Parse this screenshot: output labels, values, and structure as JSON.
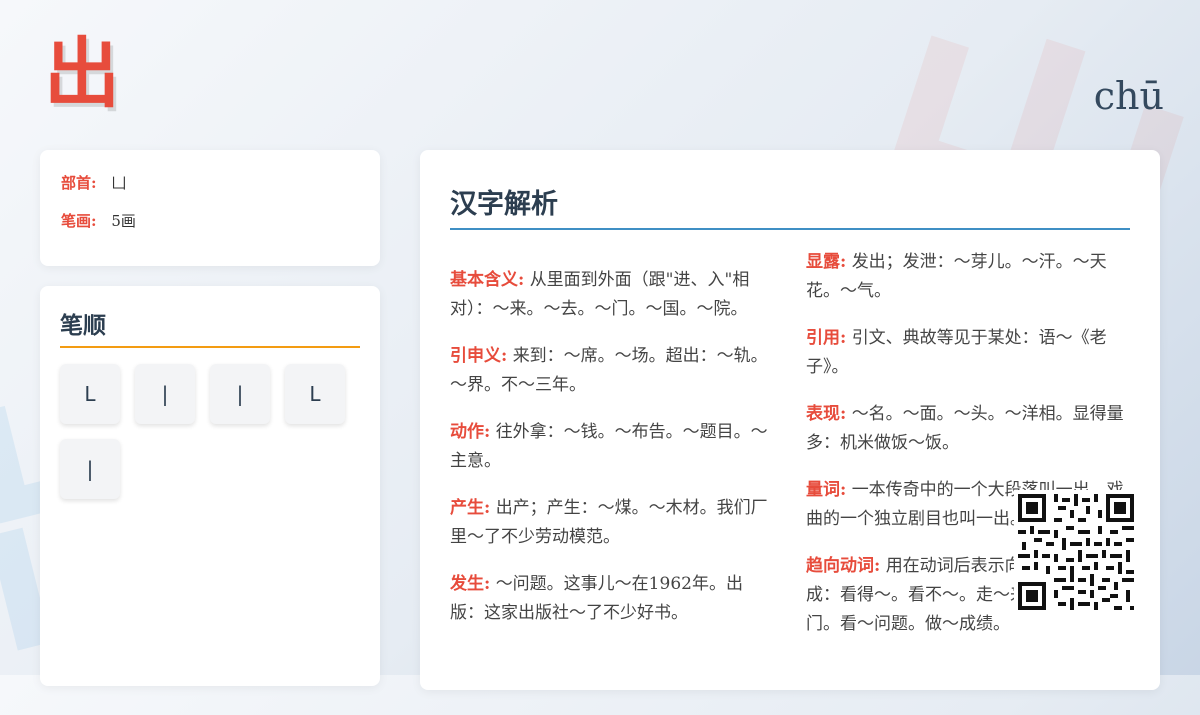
{
  "character": "出",
  "pinyin": "chū",
  "info": {
    "radical_label": "部首:",
    "radical_value": "凵",
    "strokes_label": "笔画:",
    "strokes_value": "5画"
  },
  "stroke_order": {
    "title": "笔顺",
    "strokes": [
      "L",
      "|",
      "|",
      "L",
      "|"
    ]
  },
  "analysis": {
    "title": "汉字解析",
    "left_entries": [
      {
        "term": "基本含义:",
        "text": "从里面到外面（跟\"进、入\"相对）：～来。～去。～门。～国。～院。"
      },
      {
        "term": "引申义:",
        "text": "来到：～席。～场。超出：～轨。～界。不～三年。"
      },
      {
        "term": "动作:",
        "text": "往外拿：～钱。～布告。～题目。～主意。"
      },
      {
        "term": "产生:",
        "text": "出产；产生：～煤。～木材。我们厂里～了不少劳动模范。"
      },
      {
        "term": "发生:",
        "text": "～问题。这事儿～在1962年。出版：这家出版社～了不少好书。"
      }
    ],
    "right_entries": [
      {
        "term": "显露:",
        "text": "发出；发泄：～芽儿。～汗。～天花。～气。"
      },
      {
        "term": "引用:",
        "text": "引文、典故等见于某处：语～《老子》。"
      },
      {
        "term": "表现:",
        "text": "～名。～面。～头。～洋相。显得量多：机米做饭～饭。"
      },
      {
        "term": "量词:",
        "text": "一本传奇中的一个大段落叫一出，戏曲的一个独立剧目也叫一出。"
      },
      {
        "term": "趋向动词:",
        "text": "用在动词后表示向外或动作的完成：看得～。看不～。走～来。推开～大门。看～问题。做～成绩。"
      }
    ]
  },
  "colors": {
    "accent_red": "#e74c3c",
    "heading": "#2c3e50",
    "stroke_underline": "#f39c12",
    "analysis_underline": "#3f8fc4"
  },
  "qr_icon": "qr-code-icon"
}
